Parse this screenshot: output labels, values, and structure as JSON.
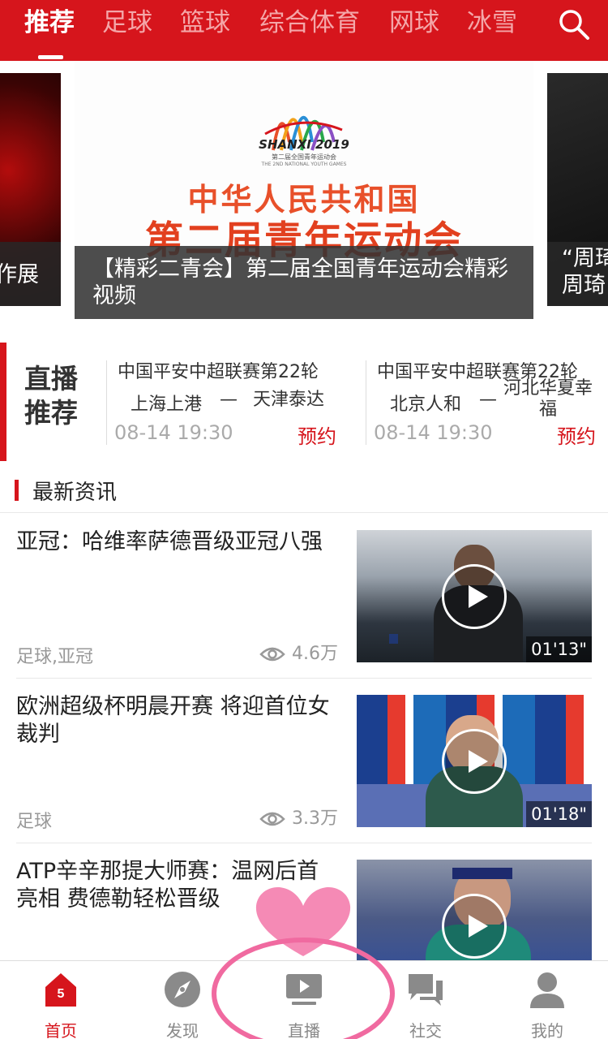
{
  "top_nav": {
    "tabs": [
      "推荐",
      "足球",
      "篮球",
      "综合体育",
      "网球",
      "冰雪"
    ],
    "active_tab": "推荐"
  },
  "carousel": {
    "left_caption": "作展",
    "main": {
      "logo_text": "SHANXI 2019",
      "logo_sub": "第二届全国青年运动会",
      "logo_sub_en": "THE 2ND NATIONAL YOUTH GAMES",
      "headline1": "中华人民共和国",
      "headline2": "第二届青年运动会",
      "caption": "【精彩二青会】第二届全国青年运动会精彩视频"
    },
    "right_caption_line1": "“周琦",
    "right_caption_line2": "周琦"
  },
  "live": {
    "title": "直播推荐",
    "matches": [
      {
        "league": "中国平安中超联赛第22轮",
        "team_a": "上海上港",
        "dash": "—",
        "team_b": "天津泰达",
        "time": "08-14 19:30",
        "action": "预约"
      },
      {
        "league": "中国平安中超联赛第22轮",
        "team_a": "北京人和",
        "dash": "—",
        "team_b": "河北华夏幸福",
        "time": "08-14 19:30",
        "action": "预约"
      }
    ]
  },
  "news": {
    "header": "最新资讯",
    "items": [
      {
        "title": "亚冠：哈维率萨德晋级亚冠八强",
        "tag": "足球,亚冠",
        "views": "4.6万",
        "duration": "01'13\""
      },
      {
        "title": "欧洲超级杯明晨开赛 将迎首位女裁判",
        "tag": "足球",
        "views": "3.3万",
        "duration": "01'18\""
      },
      {
        "title": "ATP辛辛那提大师赛：温网后首亮相 费德勒轻松晋级",
        "tag": "",
        "views": "",
        "duration": ""
      }
    ]
  },
  "tabbar": {
    "items": [
      {
        "label": "首页",
        "icon": "home-icon",
        "badge": "5"
      },
      {
        "label": "发现",
        "icon": "compass-icon"
      },
      {
        "label": "直播",
        "icon": "tv-play-icon"
      },
      {
        "label": "社交",
        "icon": "chat-icon"
      },
      {
        "label": "我的",
        "icon": "user-icon"
      }
    ],
    "active": "首页"
  },
  "colors": {
    "brand_red": "#d6151c",
    "doodle_pink": "#f06aa0"
  }
}
